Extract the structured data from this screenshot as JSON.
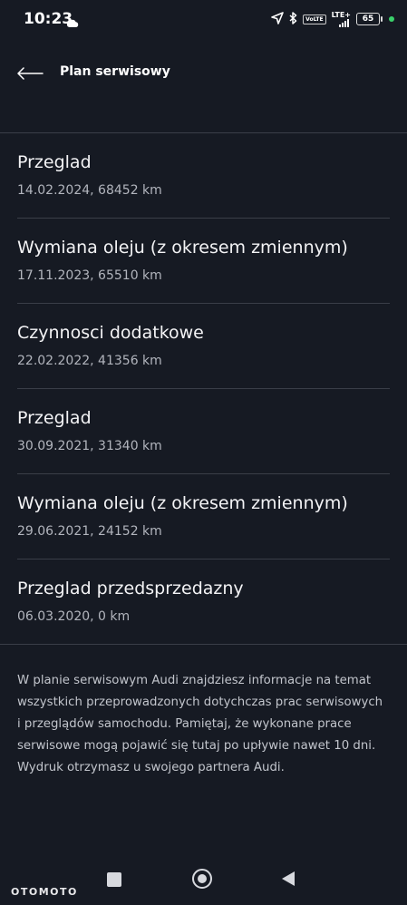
{
  "status_bar": {
    "time": "10:23",
    "lte_label": "LTE+",
    "volte_label": "VoLTE",
    "battery_level": "65",
    "icons": [
      "cloud-icon",
      "location-arrow-icon",
      "bluetooth-icon",
      "signal-icon",
      "battery-icon"
    ]
  },
  "header": {
    "title": "Plan serwisowy",
    "back_icon": "arrow-left-icon"
  },
  "services": [
    {
      "title": "Przeglad",
      "meta": "14.02.2024, 68452 km"
    },
    {
      "title": "Wymiana oleju (z okresem zmiennym)",
      "meta": "17.11.2023, 65510 km"
    },
    {
      "title": "Czynnosci dodatkowe",
      "meta": "22.02.2022, 41356 km"
    },
    {
      "title": "Przeglad",
      "meta": "30.09.2021, 31340 km"
    },
    {
      "title": "Wymiana oleju (z okresem zmiennym)",
      "meta": "29.06.2021, 24152 km"
    },
    {
      "title": "Przeglad przedsprzedazny",
      "meta": "06.03.2020, 0 km"
    }
  ],
  "info": {
    "text": "W planie serwisowym Audi znajdziesz informacje na temat wszystkich przeprowadzonych dotychczas prac serwisowych i przeglądów samochodu. Pamiętaj, że wykonane prace serwisowe mogą pojawić się tutaj po upływie nawet 10 dni. Wydruk otrzymasz u swojego partnera Audi."
  },
  "nav": {
    "icons": [
      "recents-square-icon",
      "home-circle-icon",
      "back-triangle-icon"
    ]
  },
  "watermark": "OTOMOTO",
  "colors": {
    "background": "#161a23",
    "divider": "#3a3e48",
    "primary_text": "#f3f3f5",
    "secondary_text": "#b2b5bd",
    "status_dot": "#3ad16b"
  }
}
